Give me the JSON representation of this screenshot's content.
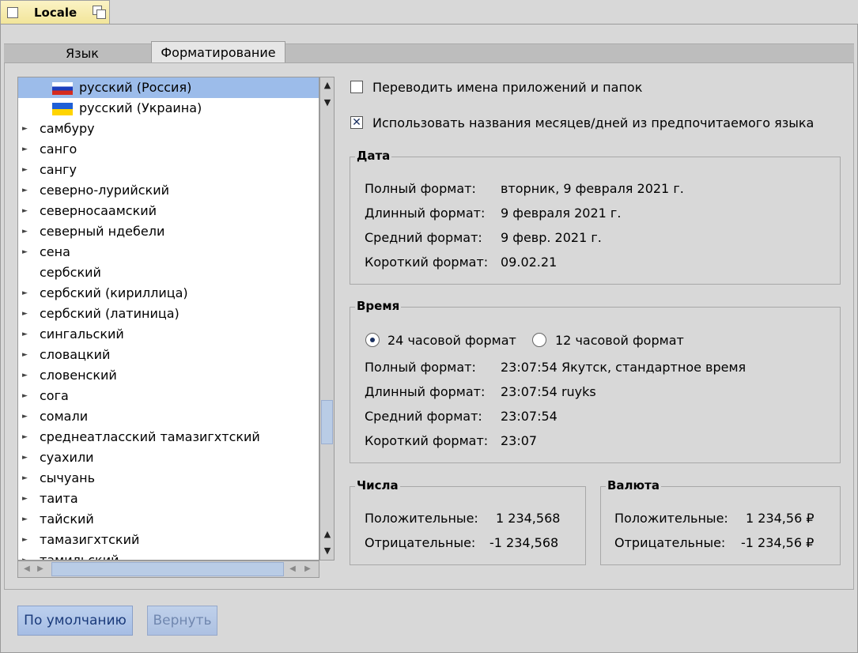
{
  "window": {
    "title": "Locale"
  },
  "tabs": [
    {
      "label": "Язык"
    },
    {
      "label": "Форматирование"
    }
  ],
  "language_list": {
    "items": [
      {
        "label": "русский (Россия)",
        "flag": "russia-flag-icon",
        "selected": true
      },
      {
        "label": "русский (Украина)",
        "flag": "ukraine-flag-icon"
      },
      {
        "label": "самбуру"
      },
      {
        "label": "санго"
      },
      {
        "label": "сангу"
      },
      {
        "label": "северно-лурийский"
      },
      {
        "label": "северносаамский"
      },
      {
        "label": "северный ндебели"
      },
      {
        "label": "сена"
      },
      {
        "label": "сербский",
        "no_arrow": true
      },
      {
        "label": "сербский (кириллица)"
      },
      {
        "label": "сербский (латиница)"
      },
      {
        "label": "сингальский"
      },
      {
        "label": "словацкий"
      },
      {
        "label": "словенский"
      },
      {
        "label": "сога"
      },
      {
        "label": "сомали"
      },
      {
        "label": "среднеатласский тамазигхтский"
      },
      {
        "label": "суахили"
      },
      {
        "label": "сычуань"
      },
      {
        "label": "таита"
      },
      {
        "label": "тайский"
      },
      {
        "label": "тамазигхтский"
      },
      {
        "label": "тамильский"
      }
    ]
  },
  "options": {
    "translate_names": {
      "label": "Переводить имена приложений и папок",
      "checked": false
    },
    "use_month_names": {
      "label": "Использовать названия месяцев/дней из предпочитаемого языка",
      "checked": true
    }
  },
  "date": {
    "title": "Дата",
    "full_label": "Полный формат:",
    "full_value": "вторник, 9 февраля 2021 г.",
    "long_label": "Длинный формат:",
    "long_value": "9 февраля 2021 г.",
    "medium_label": "Средний формат:",
    "medium_value": "9 февр. 2021 г.",
    "short_label": "Короткий формат:",
    "short_value": "09.02.21"
  },
  "time": {
    "title": "Время",
    "radio_24": "24 часовой формат",
    "radio_12": "12 часовой формат",
    "selected": "24",
    "full_label": "Полный формат:",
    "full_value": "23:07:54 Якутск, стандартное время",
    "long_label": "Длинный формат:",
    "long_value": "23:07:54 ruyks",
    "medium_label": "Средний формат:",
    "medium_value": "23:07:54",
    "short_label": "Короткий формат:",
    "short_value": "23:07"
  },
  "numbers": {
    "title": "Числа",
    "positive_label": "Положительные:",
    "positive_value": "1 234,568",
    "negative_label": "Отрицательные:",
    "negative_value": "-1 234,568"
  },
  "currency": {
    "title": "Валюта",
    "positive_label": "Положительные:",
    "positive_value": "1 234,56 ₽",
    "negative_label": "Отрицательные:",
    "negative_value": "-1 234,56 ₽"
  },
  "buttons": {
    "defaults": "По умолчанию",
    "revert": "Вернуть"
  }
}
